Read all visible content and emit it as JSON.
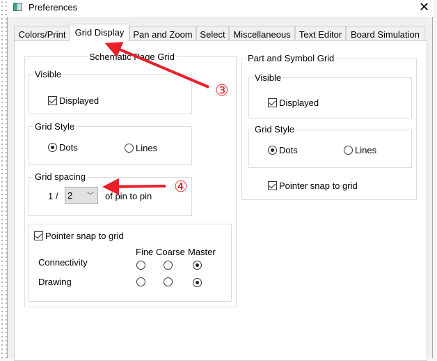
{
  "window": {
    "title": "Preferences",
    "close_icon": "close-icon"
  },
  "tabs": [
    {
      "label": "Colors/Print"
    },
    {
      "label": "Grid Display",
      "selected": true
    },
    {
      "label": "Pan and Zoom"
    },
    {
      "label": "Select"
    },
    {
      "label": "Miscellaneous"
    },
    {
      "label": "Text Editor"
    },
    {
      "label": "Board Simulation"
    }
  ],
  "schematic": {
    "title": "Schematic Page Grid",
    "visible": {
      "title": "Visible",
      "displayed_label": "Displayed",
      "displayed": true
    },
    "grid_style": {
      "title": "Grid Style",
      "dots": "Dots",
      "lines": "Lines",
      "selected": "Dots"
    },
    "grid_spacing": {
      "title": "Grid spacing",
      "prefix": "1 /",
      "value": "2",
      "suffix": "of pin to pin"
    },
    "snap": {
      "label": "Pointer snap to grid",
      "checked": true,
      "cols": [
        "Fine",
        "Coarse",
        "Master"
      ],
      "rows": [
        {
          "label": "Connectivity",
          "selected": "Master"
        },
        {
          "label": "Drawing",
          "selected": "Master"
        }
      ]
    }
  },
  "part": {
    "title": "Part and Symbol Grid",
    "visible": {
      "title": "Visible",
      "displayed_label": "Displayed",
      "displayed": true
    },
    "grid_style": {
      "title": "Grid Style",
      "dots": "Dots",
      "lines": "Lines",
      "selected": "Dots"
    },
    "snap_label": "Pointer snap to grid",
    "snap": true
  },
  "annotations": {
    "marker3": "③",
    "marker4": "④",
    "color": "#e8202a"
  }
}
